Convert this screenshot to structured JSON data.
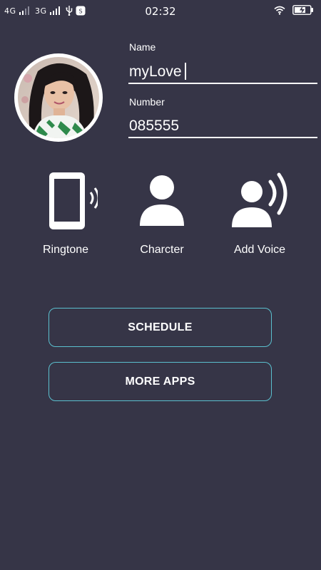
{
  "status_bar": {
    "network1": "4G",
    "network2": "3G",
    "time": "02:32"
  },
  "contact": {
    "name_label": "Name",
    "name_value": "myLove",
    "number_label": "Number",
    "number_value": "085555"
  },
  "features": [
    {
      "label": "Ringtone",
      "icon": "phone-vibrate-icon"
    },
    {
      "label": "Charcter",
      "icon": "person-icon"
    },
    {
      "label": "Add Voice",
      "icon": "person-voice-icon"
    }
  ],
  "buttons": {
    "schedule": "SCHEDULE",
    "more_apps": "MORE APPS"
  },
  "colors": {
    "background": "#363547",
    "button_border": "#5bc0cf",
    "foreground": "#ffffff"
  }
}
